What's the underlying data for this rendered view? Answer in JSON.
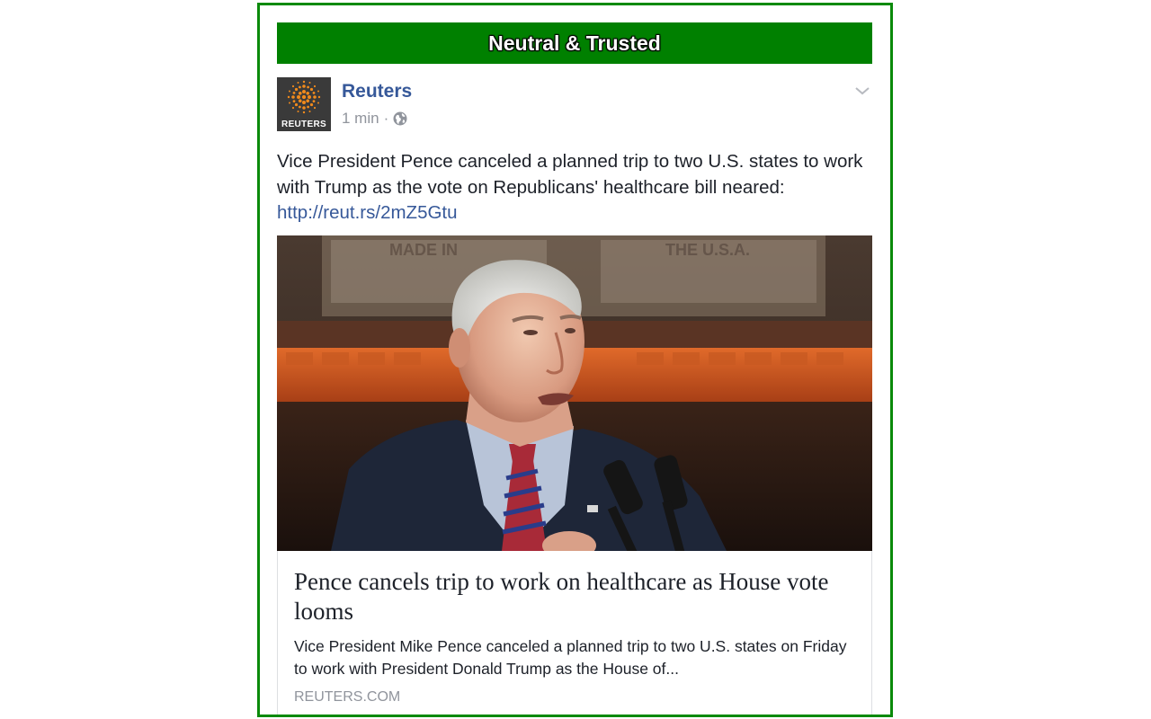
{
  "banner": {
    "label": "Neutral & Trusted",
    "color": "#008000",
    "border_color": "#0a8a0a"
  },
  "post": {
    "page_name": "Reuters",
    "avatar_label": "REUTERS",
    "timestamp": "1 min",
    "separator": "·",
    "privacy_icon": "globe-icon",
    "menu_icon": "chevron-down-icon",
    "text": "Vice President Pence canceled a planned trip to two U.S. states to work with Trump as the vote on Republicans' healthcare bill neared:",
    "link_text": "http://reut.rs/2mZ5Gtu"
  },
  "link_preview": {
    "title": "Pence cancels trip to work on healthcare as House vote looms",
    "description": "Vice President Mike Pence canceled a planned trip to two U.S. states on Friday to work with President Donald Trump as the House of...",
    "domain": "REUTERS.COM",
    "background_signage": {
      "left": "MADE IN",
      "right": "THE U.S.A."
    }
  },
  "colors": {
    "link": "#365899",
    "text": "#1d2129",
    "muted": "#90949c",
    "reuters_orange": "#f08a1c"
  }
}
